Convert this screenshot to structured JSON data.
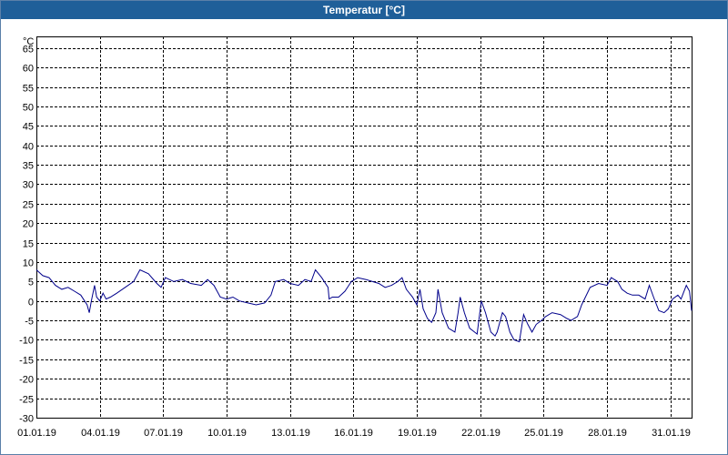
{
  "window": {
    "title": "Temperatur [°C]"
  },
  "chart_data": {
    "type": "line",
    "title": "Temperatur [°C]",
    "unit_label": "°C",
    "xlabel": "",
    "ylabel": "",
    "ylim": [
      -30,
      68
    ],
    "yticks": [
      65,
      60,
      55,
      50,
      45,
      40,
      35,
      30,
      25,
      20,
      15,
      10,
      5,
      0,
      -5,
      -10,
      -15,
      -20,
      -25,
      -30
    ],
    "xlim": [
      "01.01.19 00:00",
      "01.02.19 00:00"
    ],
    "xticks": [
      {
        "label": "01.01.19",
        "day": 1
      },
      {
        "label": "04.01.19",
        "day": 4
      },
      {
        "label": "07.01.19",
        "day": 7
      },
      {
        "label": "10.01.19",
        "day": 10
      },
      {
        "label": "13.01.19",
        "day": 13
      },
      {
        "label": "16.01.19",
        "day": 16
      },
      {
        "label": "19.01.19",
        "day": 19
      },
      {
        "label": "22.01.19",
        "day": 22
      },
      {
        "label": "25.01.19",
        "day": 25
      },
      {
        "label": "28.01.19",
        "day": 28
      },
      {
        "label": "31.01.19",
        "day": 31
      }
    ],
    "grid": true,
    "grid_style": "dashed",
    "line_color": "#00008b",
    "series": [
      {
        "values": [
          [
            1.0,
            8
          ],
          [
            1.3,
            6.5
          ],
          [
            1.6,
            6
          ],
          [
            1.9,
            4
          ],
          [
            2.2,
            3
          ],
          [
            2.5,
            3.5
          ],
          [
            2.8,
            2.5
          ],
          [
            3.1,
            1.5
          ],
          [
            3.4,
            -1
          ],
          [
            3.5,
            -3
          ],
          [
            3.6,
            0
          ],
          [
            3.75,
            4
          ],
          [
            3.85,
            1
          ],
          [
            4.0,
            0
          ],
          [
            4.15,
            2
          ],
          [
            4.3,
            0.5
          ],
          [
            4.5,
            1
          ],
          [
            4.8,
            2
          ],
          [
            5.2,
            3.5
          ],
          [
            5.6,
            5
          ],
          [
            5.9,
            8
          ],
          [
            6.3,
            7
          ],
          [
            6.7,
            4.5
          ],
          [
            6.9,
            3.5
          ],
          [
            7.1,
            6
          ],
          [
            7.5,
            5
          ],
          [
            7.9,
            5.5
          ],
          [
            8.3,
            4.5
          ],
          [
            8.8,
            4
          ],
          [
            9.1,
            5.5
          ],
          [
            9.4,
            4
          ],
          [
            9.7,
            1
          ],
          [
            10.0,
            0.5
          ],
          [
            10.3,
            1
          ],
          [
            10.6,
            0
          ],
          [
            11.0,
            -0.5
          ],
          [
            11.4,
            -1
          ],
          [
            11.8,
            -0.5
          ],
          [
            12.1,
            1.5
          ],
          [
            12.3,
            5
          ],
          [
            12.7,
            5.5
          ],
          [
            13.0,
            4.5
          ],
          [
            13.4,
            4
          ],
          [
            13.7,
            5.5
          ],
          [
            14.0,
            5
          ],
          [
            14.2,
            8
          ],
          [
            14.5,
            6
          ],
          [
            14.8,
            3.5
          ],
          [
            14.85,
            0.5
          ],
          [
            15.0,
            1
          ],
          [
            15.3,
            1
          ],
          [
            15.6,
            2.5
          ],
          [
            15.9,
            5
          ],
          [
            16.2,
            6
          ],
          [
            16.6,
            5.5
          ],
          [
            16.9,
            5
          ],
          [
            17.2,
            4.5
          ],
          [
            17.5,
            3.5
          ],
          [
            17.8,
            4
          ],
          [
            18.1,
            5
          ],
          [
            18.3,
            6
          ],
          [
            18.5,
            3
          ],
          [
            18.8,
            1
          ],
          [
            19.0,
            -1
          ],
          [
            19.15,
            3
          ],
          [
            19.3,
            -2
          ],
          [
            19.5,
            -4.5
          ],
          [
            19.7,
            -5.5
          ],
          [
            19.9,
            -3
          ],
          [
            20.0,
            3
          ],
          [
            20.2,
            -3
          ],
          [
            20.5,
            -7
          ],
          [
            20.8,
            -8
          ],
          [
            20.95,
            -3
          ],
          [
            21.05,
            1
          ],
          [
            21.25,
            -3
          ],
          [
            21.5,
            -7
          ],
          [
            21.85,
            -8.5
          ],
          [
            22.05,
            0
          ],
          [
            22.25,
            -3
          ],
          [
            22.5,
            -8
          ],
          [
            22.7,
            -9
          ],
          [
            22.8,
            -8
          ],
          [
            23.05,
            -3
          ],
          [
            23.2,
            -4
          ],
          [
            23.4,
            -8
          ],
          [
            23.6,
            -10
          ],
          [
            23.85,
            -10.5
          ],
          [
            24.05,
            -3.5
          ],
          [
            24.25,
            -6
          ],
          [
            24.45,
            -8
          ],
          [
            24.65,
            -6
          ],
          [
            24.9,
            -5
          ],
          [
            25.1,
            -4
          ],
          [
            25.4,
            -3
          ],
          [
            25.8,
            -3.5
          ],
          [
            26.1,
            -4.5
          ],
          [
            26.3,
            -5
          ],
          [
            26.6,
            -4
          ],
          [
            26.8,
            -1
          ],
          [
            27.2,
            3.5
          ],
          [
            27.6,
            4.5
          ],
          [
            28.0,
            4
          ],
          [
            28.2,
            6
          ],
          [
            28.5,
            5
          ],
          [
            28.7,
            3
          ],
          [
            28.95,
            2
          ],
          [
            29.2,
            1.5
          ],
          [
            29.5,
            1.5
          ],
          [
            29.8,
            0.5
          ],
          [
            30.0,
            4
          ],
          [
            30.2,
            1
          ],
          [
            30.45,
            -2.5
          ],
          [
            30.7,
            -3
          ],
          [
            30.9,
            -2
          ],
          [
            31.1,
            0.5
          ],
          [
            31.35,
            1.5
          ],
          [
            31.5,
            0.5
          ],
          [
            31.75,
            4
          ],
          [
            31.9,
            2.5
          ],
          [
            32.0,
            -2.5
          ]
        ]
      }
    ]
  }
}
